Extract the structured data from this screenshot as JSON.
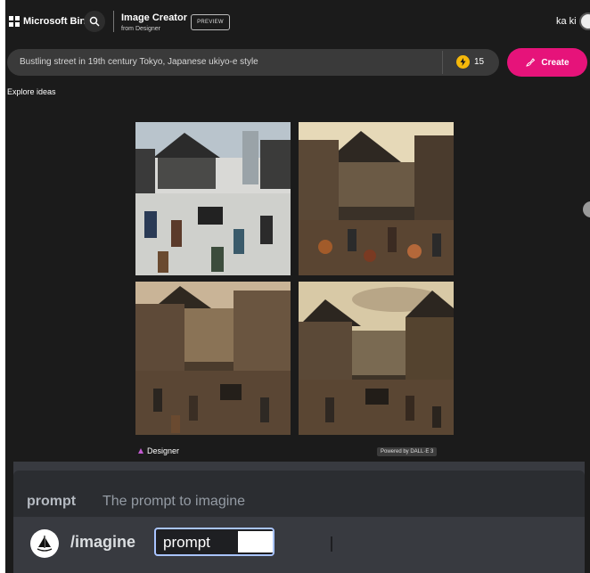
{
  "header": {
    "brand": "Microsoft Bing",
    "product_title": "Image Creator",
    "product_subtitle": "from Designer",
    "preview_badge": "PREVIEW",
    "username": "ka ki"
  },
  "prompt_bar": {
    "prompt_text": "Bustling street in 19th century Tokyo, Japanese ukiyo-e style",
    "boost_count": "15",
    "create_label": "Create"
  },
  "explore_label": "Explore ideas",
  "results": {
    "images": [
      {
        "id": 1
      },
      {
        "id": 2
      },
      {
        "id": 3
      },
      {
        "id": 4
      }
    ],
    "designer_label": "Designer",
    "powered_by": "Powered by DALL·E 3"
  },
  "discord": {
    "option_name": "prompt",
    "option_description": "The prompt to imagine",
    "command": "/imagine",
    "param_label": "prompt"
  },
  "colors": {
    "background": "#1b1b1b",
    "create_button": "#e6137a",
    "boost_coin": "#f5b80a",
    "discord_panel": "#2b2d31",
    "discord_input": "#383a40",
    "param_border": "#a9c4ff"
  }
}
